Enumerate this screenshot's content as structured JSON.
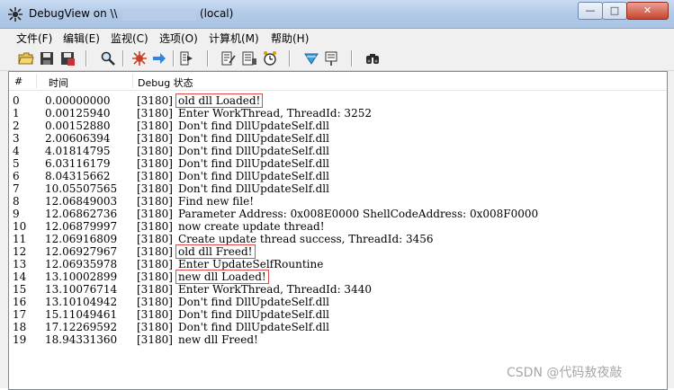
{
  "window": {
    "title_prefix": "DebugView on \\\\",
    "title_suffix": "(local)",
    "minimize_glyph": "—",
    "maximize_glyph": "□",
    "close_glyph": "✕"
  },
  "menu": [
    {
      "label": "文件(F)"
    },
    {
      "label": "编辑(E)"
    },
    {
      "label": "监视(C)"
    },
    {
      "label": "选项(O)"
    },
    {
      "label": "计算机(M)"
    },
    {
      "label": "帮助(H)"
    }
  ],
  "toolbar": [
    {
      "icon": "open-folder-icon"
    },
    {
      "icon": "save-icon"
    },
    {
      "icon": "save-as-icon"
    },
    {
      "icon": "find-icon"
    },
    {
      "icon": "capture-icon"
    },
    {
      "icon": "autoscroll-arrow-icon"
    },
    {
      "icon": "clear-icon"
    },
    {
      "icon": "filter-icon"
    },
    {
      "icon": "properties-icon"
    },
    {
      "icon": "clock-icon"
    },
    {
      "icon": "highlight-icon"
    },
    {
      "icon": "history-icon"
    },
    {
      "icon": "binoculars-icon"
    }
  ],
  "columns": {
    "index": "#",
    "time": "时间",
    "debug": "Debug 状态"
  },
  "rows": [
    {
      "idx": "0",
      "time": "0.00000000",
      "pid": "[3180]",
      "msg": "old dll Loaded!",
      "highlight": true
    },
    {
      "idx": "1",
      "time": "0.00125940",
      "pid": "[3180]",
      "msg": "Enter WorkThread, ThreadId: 3252",
      "highlight": false
    },
    {
      "idx": "2",
      "time": "0.00152880",
      "pid": "[3180]",
      "msg": "Don't find DllUpdateSelf.dll",
      "highlight": false
    },
    {
      "idx": "3",
      "time": "2.00606394",
      "pid": "[3180]",
      "msg": "Don't find DllUpdateSelf.dll",
      "highlight": false
    },
    {
      "idx": "4",
      "time": "4.01814795",
      "pid": "[3180]",
      "msg": "Don't find DllUpdateSelf.dll",
      "highlight": false
    },
    {
      "idx": "5",
      "time": "6.03116179",
      "pid": "[3180]",
      "msg": "Don't find DllUpdateSelf.dll",
      "highlight": false
    },
    {
      "idx": "6",
      "time": "8.04315662",
      "pid": "[3180]",
      "msg": "Don't find DllUpdateSelf.dll",
      "highlight": false
    },
    {
      "idx": "7",
      "time": "10.05507565",
      "pid": "[3180]",
      "msg": "Don't find DllUpdateSelf.dll",
      "highlight": false
    },
    {
      "idx": "8",
      "time": "12.06849003",
      "pid": "[3180]",
      "msg": "Find new file!",
      "highlight": false
    },
    {
      "idx": "9",
      "time": "12.06862736",
      "pid": "[3180]",
      "msg": "Parameter Address: 0x008E0000    ShellCodeAddress: 0x008F0000",
      "highlight": false
    },
    {
      "idx": "10",
      "time": "12.06879997",
      "pid": "[3180]",
      "msg": "now create update thread!",
      "highlight": false
    },
    {
      "idx": "11",
      "time": "12.06916809",
      "pid": "[3180]",
      "msg": "Create update thread success, ThreadId: 3456",
      "highlight": false
    },
    {
      "idx": "12",
      "time": "12.06927967",
      "pid": "[3180]",
      "msg": "old dll Freed!",
      "highlight": true
    },
    {
      "idx": "13",
      "time": "12.06935978",
      "pid": "[3180]",
      "msg": "Enter UpdateSelfRountine",
      "highlight": false
    },
    {
      "idx": "14",
      "time": "13.10002899",
      "pid": "[3180]",
      "msg": "new dll Loaded!",
      "highlight": true
    },
    {
      "idx": "15",
      "time": "13.10076714",
      "pid": "[3180]",
      "msg": "Enter WorkThread, ThreadId: 3440",
      "highlight": false
    },
    {
      "idx": "16",
      "time": "13.10104942",
      "pid": "[3180]",
      "msg": "Don't find DllUpdateSelf.dll",
      "highlight": false
    },
    {
      "idx": "17",
      "time": "15.11049461",
      "pid": "[3180]",
      "msg": "Don't find DllUpdateSelf.dll",
      "highlight": false
    },
    {
      "idx": "18",
      "time": "17.12269592",
      "pid": "[3180]",
      "msg": "Don't find DllUpdateSelf.dll",
      "highlight": false
    },
    {
      "idx": "19",
      "time": "18.94331360",
      "pid": "[3180]",
      "msg": "new dll Freed!",
      "highlight": false
    }
  ],
  "watermark": "CSDN @代码敖夜敲",
  "colors": {
    "highlight_border": "#e04a4a",
    "titlebar": "#b3cbe8"
  }
}
